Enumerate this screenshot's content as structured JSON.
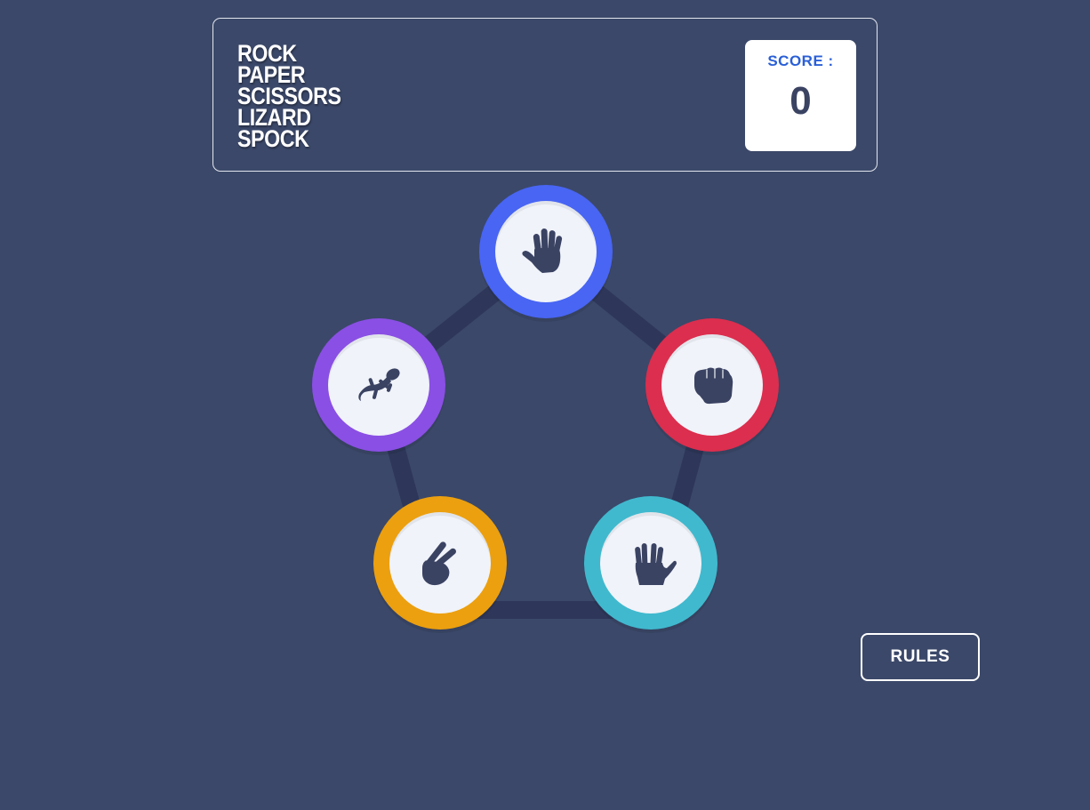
{
  "header": {
    "logo_words": [
      "ROCK",
      "PAPER",
      "SCISSORS",
      "LIZARD",
      "SPOCK"
    ],
    "score_label": "SCORE :",
    "score_value": "0"
  },
  "tokens": [
    {
      "id": "paper",
      "icon": "paper-hand-icon",
      "color": "#4865f4"
    },
    {
      "id": "rock",
      "icon": "rock-fist-icon",
      "color": "#dc2e4e"
    },
    {
      "id": "spock",
      "icon": "spock-hand-icon",
      "color": "#40b9ce"
    },
    {
      "id": "scissors",
      "icon": "scissors-hand-icon",
      "color": "#eca00f"
    },
    {
      "id": "lizard",
      "icon": "lizard-icon",
      "color": "#8a4fe4"
    }
  ],
  "colors": {
    "background": "#3b4869",
    "connector": "#2e3759",
    "token_inner": "#f0f3f9",
    "icon_fill": "#3b4363"
  },
  "rules_button": {
    "label": "RULES"
  }
}
